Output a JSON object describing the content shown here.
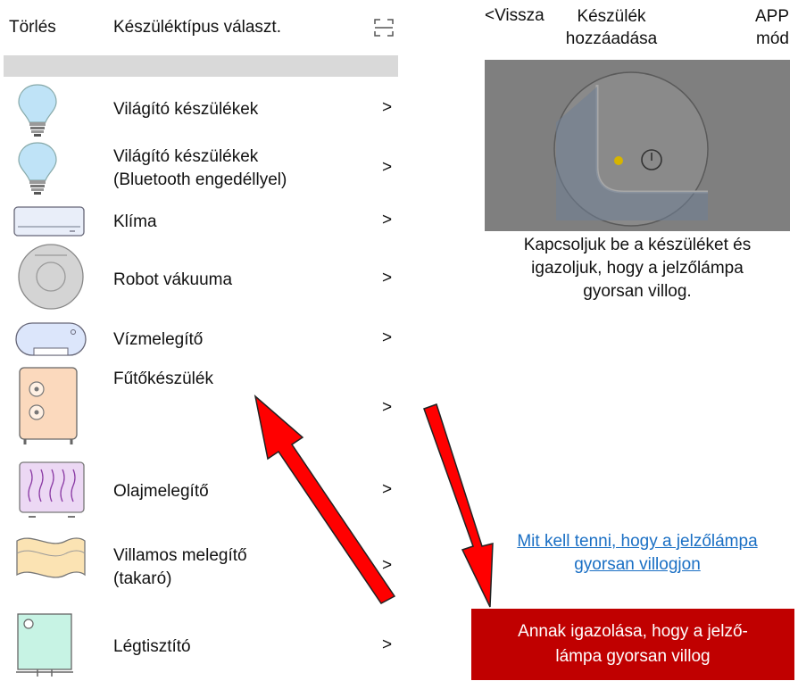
{
  "left_header": {
    "delete_label": "Törlés",
    "title": "Készüléktípus választ."
  },
  "right_header": {
    "back_label": "<Vissza",
    "title_line1": "Készülék",
    "title_line2": "hozzáadása",
    "mode_line1": "APP",
    "mode_line2": "mód"
  },
  "devices": [
    {
      "label_line1": "Világító készülékek",
      "label_line2": "",
      "chevron": ">",
      "icon": "bulb-icon"
    },
    {
      "label_line1": "Világító készülékek",
      "label_line2": "(Bluetooth engedéllyel)",
      "chevron": ">",
      "icon": "bulb-icon"
    },
    {
      "label_line1": "Klíma",
      "label_line2": "",
      "chevron": ">",
      "icon": "air-conditioner-icon"
    },
    {
      "label_line1": "Robot vákuuma",
      "label_line2": "",
      "chevron": ">",
      "icon": "robot-vacuum-icon"
    },
    {
      "label_line1": "Vízmelegítő",
      "label_line2": "",
      "chevron": ">",
      "icon": "water-heater-icon"
    },
    {
      "label_line1": "Fűtőkészülék",
      "label_line2": "",
      "chevron": ">",
      "icon": "heater-icon"
    },
    {
      "label_line1": "Olajmelegítő",
      "label_line2": "",
      "chevron": ">",
      "icon": "oil-heater-icon"
    },
    {
      "label_line1": "Villamos melegítő",
      "label_line2": "(takaró)",
      "chevron": ">",
      "icon": "electric-blanket-icon"
    },
    {
      "label_line1": "Légtisztító",
      "label_line2": "",
      "chevron": ">",
      "icon": "air-purifier-icon"
    }
  ],
  "instruction": {
    "line1": "Kapcsoljuk be a készüléket és",
    "line2": "igazoljuk, hogy a jelzőlámpa",
    "line3": "gyorsan villog."
  },
  "help_link": {
    "line1": "Mit kell tenni, hogy a jelzőlámpa",
    "line2": "gyorsan villogjon"
  },
  "confirm_button": {
    "line1": "Annak igazolása, hogy a jelző-",
    "line2": "lámpa gyorsan villog"
  },
  "colors": {
    "accent_red": "#c00000",
    "link_blue": "#1a6fc4",
    "arrow_red": "#ff0000"
  }
}
